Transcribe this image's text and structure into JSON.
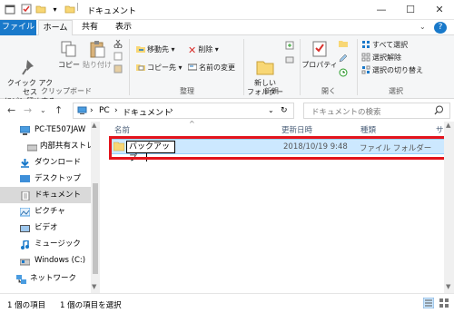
{
  "window": {
    "title": "ドキュメント",
    "minimize": "—",
    "maximize": "☐",
    "close": "✕"
  },
  "tabs": {
    "file": "ファイル",
    "home": "ホーム",
    "share": "共有",
    "view": "表示"
  },
  "ribbon": {
    "clipboard": {
      "quick_access": "クイック アクセス\nにピン留めする",
      "copy": "コピー",
      "paste": "貼り付け",
      "label": "クリップボード"
    },
    "organize": {
      "move_to": "移動先 ▾",
      "copy_to": "コピー先 ▾",
      "delete": "削除 ▾",
      "rename": "名前の変更",
      "label": "整理"
    },
    "new": {
      "new_folder": "新しい\nフォルダー",
      "label": "新規"
    },
    "open": {
      "properties": "プロパティ",
      "label": "開く"
    },
    "select": {
      "select_all": "すべて選択",
      "select_none": "選択解除",
      "invert": "選択の切り替え",
      "label": "選択"
    }
  },
  "address": {
    "crumbs": [
      "PC",
      "ドキュメント"
    ],
    "search_placeholder": "ドキュメントの検索"
  },
  "nav": [
    {
      "label": "PC-TE507JAW",
      "icon": "computer-icon"
    },
    {
      "label": "内部共有ストレー",
      "icon": "drive-icon"
    },
    {
      "label": "ダウンロード",
      "icon": "download-icon"
    },
    {
      "label": "デスクトップ",
      "icon": "desktop-icon"
    },
    {
      "label": "ドキュメント",
      "icon": "documents-icon"
    },
    {
      "label": "ピクチャ",
      "icon": "pictures-icon"
    },
    {
      "label": "ビデオ",
      "icon": "video-icon"
    },
    {
      "label": "ミュージック",
      "icon": "music-icon"
    },
    {
      "label": "Windows (C:)",
      "icon": "windows-drive-icon"
    },
    {
      "label": "ネットワーク",
      "icon": "network-icon"
    }
  ],
  "columns": {
    "name": "名前",
    "modified": "更新日時",
    "type": "種類",
    "size": "サイズ"
  },
  "files": [
    {
      "name": "バックアップ",
      "modified": "2018/10/19 9:48",
      "type": "ファイル フォルダー"
    }
  ],
  "status": {
    "count": "1 個の項目",
    "selected": "1 個の項目を選択"
  },
  "colors": {
    "accent": "#1979ca",
    "selection": "#cce8ff",
    "highlight": "#e3141c",
    "folder": "#f8d775"
  }
}
